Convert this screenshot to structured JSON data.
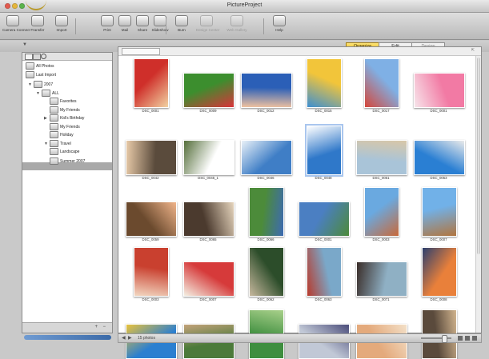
{
  "window": {
    "title": "PictureProject"
  },
  "toolbar": {
    "buttons": [
      {
        "label": "Camera Connect",
        "dim": false
      },
      {
        "label": "Transfer",
        "dim": false
      },
      {
        "label": "Import",
        "dim": false
      },
      {
        "label": "Print",
        "dim": false
      },
      {
        "label": "Mail",
        "dim": false
      },
      {
        "label": "Share",
        "dim": false
      },
      {
        "label": "Slideshow",
        "dim": false
      },
      {
        "label": "Burn",
        "dim": false
      },
      {
        "label": "Design Center",
        "dim": true
      },
      {
        "label": "Web Gallery",
        "dim": true
      },
      {
        "label": "Help",
        "dim": false
      }
    ]
  },
  "modes": [
    "Organize",
    "Edit",
    "Design"
  ],
  "sidebar": {
    "items": [
      {
        "label": "All Photos",
        "indent": 0,
        "tri": ""
      },
      {
        "label": "Last Import",
        "indent": 0,
        "tri": ""
      },
      {
        "label": "2007",
        "indent": 1,
        "tri": "▼"
      },
      {
        "label": "ALL",
        "indent": 2,
        "tri": "▼"
      },
      {
        "label": "Favorites",
        "indent": 3,
        "tri": ""
      },
      {
        "label": "My Friends",
        "indent": 3,
        "tri": ""
      },
      {
        "label": "Kid's Birthday",
        "indent": 3,
        "tri": "▶"
      },
      {
        "label": "My Friends",
        "indent": 3,
        "tri": ""
      },
      {
        "label": "Holiday",
        "indent": 3,
        "tri": ""
      },
      {
        "label": "Travel",
        "indent": 3,
        "tri": "▼"
      },
      {
        "label": "Landscape",
        "indent": 3,
        "tri": ""
      },
      {
        "label": "Summer 2007",
        "indent": 3,
        "tri": ""
      }
    ]
  },
  "main": {
    "photos": [
      {
        "caption": "DSC_0001",
        "c1": "#cf2f2a",
        "c2": "#f1d2a2",
        "portrait": true,
        "selected": false
      },
      {
        "caption": "DSC_0009",
        "c1": "#3c8e2e",
        "c2": "#d9343a",
        "portrait": false,
        "selected": false
      },
      {
        "caption": "DSC_0012",
        "c1": "#2b5fb7",
        "c2": "#f0c2a0",
        "portrait": false,
        "selected": false
      },
      {
        "caption": "DSC_0015",
        "c1": "#f2c53a",
        "c2": "#3d8fd1",
        "portrait": true,
        "selected": false
      },
      {
        "caption": "DSC_0017",
        "c1": "#7fb0e5",
        "c2": "#d5463a",
        "portrait": true,
        "selected": false
      },
      {
        "caption": "DSC_0001",
        "c1": "#f27aa4",
        "c2": "#f7e4ea",
        "portrait": false,
        "selected": false
      },
      {
        "caption": "DSC_0042",
        "c1": "#5a4b3c",
        "c2": "#e8caa8",
        "portrait": false,
        "selected": false
      },
      {
        "caption": "DSC_0045_1",
        "c1": "#ffffff",
        "c2": "#546e3a",
        "portrait": false,
        "selected": false
      },
      {
        "caption": "DSC_0046",
        "c1": "#3f7ec6",
        "c2": "#e9f1f8",
        "portrait": false,
        "selected": false
      },
      {
        "caption": "DSC_0048",
        "c1": "#2f78c9",
        "c2": "#ffffff",
        "portrait": true,
        "selected": true
      },
      {
        "caption": "DSC_0051",
        "c1": "#a9c4d8",
        "c2": "#d8c7a8",
        "portrait": false,
        "selected": false
      },
      {
        "caption": "DSC_0053",
        "c1": "#2a7fd3",
        "c2": "#eaeaea",
        "portrait": false,
        "selected": false
      },
      {
        "caption": "DSC_0059",
        "c1": "#6b4a2e",
        "c2": "#f0b48a",
        "portrait": false,
        "selected": false
      },
      {
        "caption": "DSC_0065",
        "c1": "#4b3a2e",
        "c2": "#e6d5bd",
        "portrait": false,
        "selected": false
      },
      {
        "caption": "DSC_0066",
        "c1": "#4c8b3a",
        "c2": "#3d6ab2",
        "portrait": true,
        "selected": false
      },
      {
        "caption": "DSC_0001",
        "c1": "#4b7fc2",
        "c2": "#4c8a3a",
        "portrait": false,
        "selected": false
      },
      {
        "caption": "DSC_0003",
        "c1": "#6aa9e0",
        "c2": "#c8693a",
        "portrait": true,
        "selected": false
      },
      {
        "caption": "DSC_0007",
        "c1": "#71b1e8",
        "c2": "#b1753e",
        "portrait": true,
        "selected": false
      },
      {
        "caption": "DSC_0003",
        "c1": "#c9402f",
        "c2": "#f2d7c1",
        "portrait": true,
        "selected": false
      },
      {
        "caption": "DSC_0007",
        "c1": "#d63a3a",
        "c2": "#f4f0e3",
        "portrait": false,
        "selected": false
      },
      {
        "caption": "DSC_0062",
        "c1": "#2c4d2a",
        "c2": "#c7b89e",
        "portrait": true,
        "selected": false
      },
      {
        "caption": "DSC_0063",
        "c1": "#7aa8c9",
        "c2": "#b83a2c",
        "portrait": true,
        "selected": false
      },
      {
        "caption": "DSC_0071",
        "c1": "#8fb0c4",
        "c2": "#3a2d28",
        "portrait": false,
        "selected": false
      },
      {
        "caption": "DSC_0008",
        "c1": "#e9803a",
        "c2": "#2b3f6e",
        "portrait": true,
        "selected": false
      },
      {
        "caption": "",
        "c1": "#2b7fd0",
        "c2": "#e9c23a",
        "portrait": false,
        "selected": false
      },
      {
        "caption": "",
        "c1": "#4b7a3a",
        "c2": "#c3a27a",
        "portrait": false,
        "selected": false
      },
      {
        "caption": "",
        "c1": "#3e8e3f",
        "c2": "#a8d08a",
        "portrait": true,
        "selected": false
      },
      {
        "caption": "",
        "c1": "#c1c8d6",
        "c2": "#4a4c7a",
        "portrait": false,
        "selected": false
      },
      {
        "caption": "",
        "c1": "#e4aa7c",
        "c2": "#f3e0c8",
        "portrait": false,
        "selected": false
      },
      {
        "caption": "",
        "c1": "#5a4a3c",
        "c2": "#d1b48e",
        "portrait": true,
        "selected": false
      }
    ]
  },
  "status": {
    "count": "15 photos"
  }
}
